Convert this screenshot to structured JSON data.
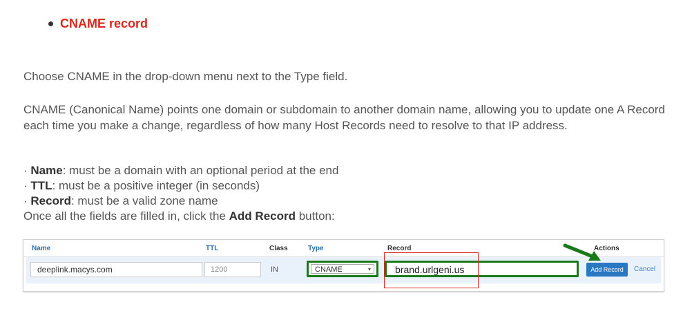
{
  "heading": "CNAME record",
  "paragraph1": "Choose CNAME in the drop-down menu next to the Type field.",
  "paragraph2": "CNAME (Canonical Name) points one domain or subdomain to another domain name, allowing you to update one A Record each time you make a change, regardless of how many Host Records need to resolve to that IP address.",
  "rules": [
    {
      "prefix": "· ",
      "term": "Name",
      "text": ": must be a domain with an optional period at the end"
    },
    {
      "prefix": "· ",
      "term": "TTL",
      "text": ": must be a positive integer (in seconds)"
    },
    {
      "prefix": "· ",
      "term": "Record",
      "text": ": must be a valid zone name"
    }
  ],
  "instruction": {
    "before": "Once all the fields are filled in, click the ",
    "strong": "Add Record",
    "after": " button:"
  },
  "screenshot": {
    "headers": {
      "name": "Name",
      "ttl": "TTL",
      "class": "Class",
      "type": "Type",
      "record": "Record",
      "actions": "Actions"
    },
    "row": {
      "name": "deeplink.macys.com",
      "ttl": "1200",
      "class": "IN",
      "type": "CNAME",
      "record": "brand.urlgeni.us"
    },
    "add_button": "Add Record",
    "cancel": "Cancel",
    "highlight_color": "#1a7a1a",
    "outline_color": "#d9291c"
  }
}
